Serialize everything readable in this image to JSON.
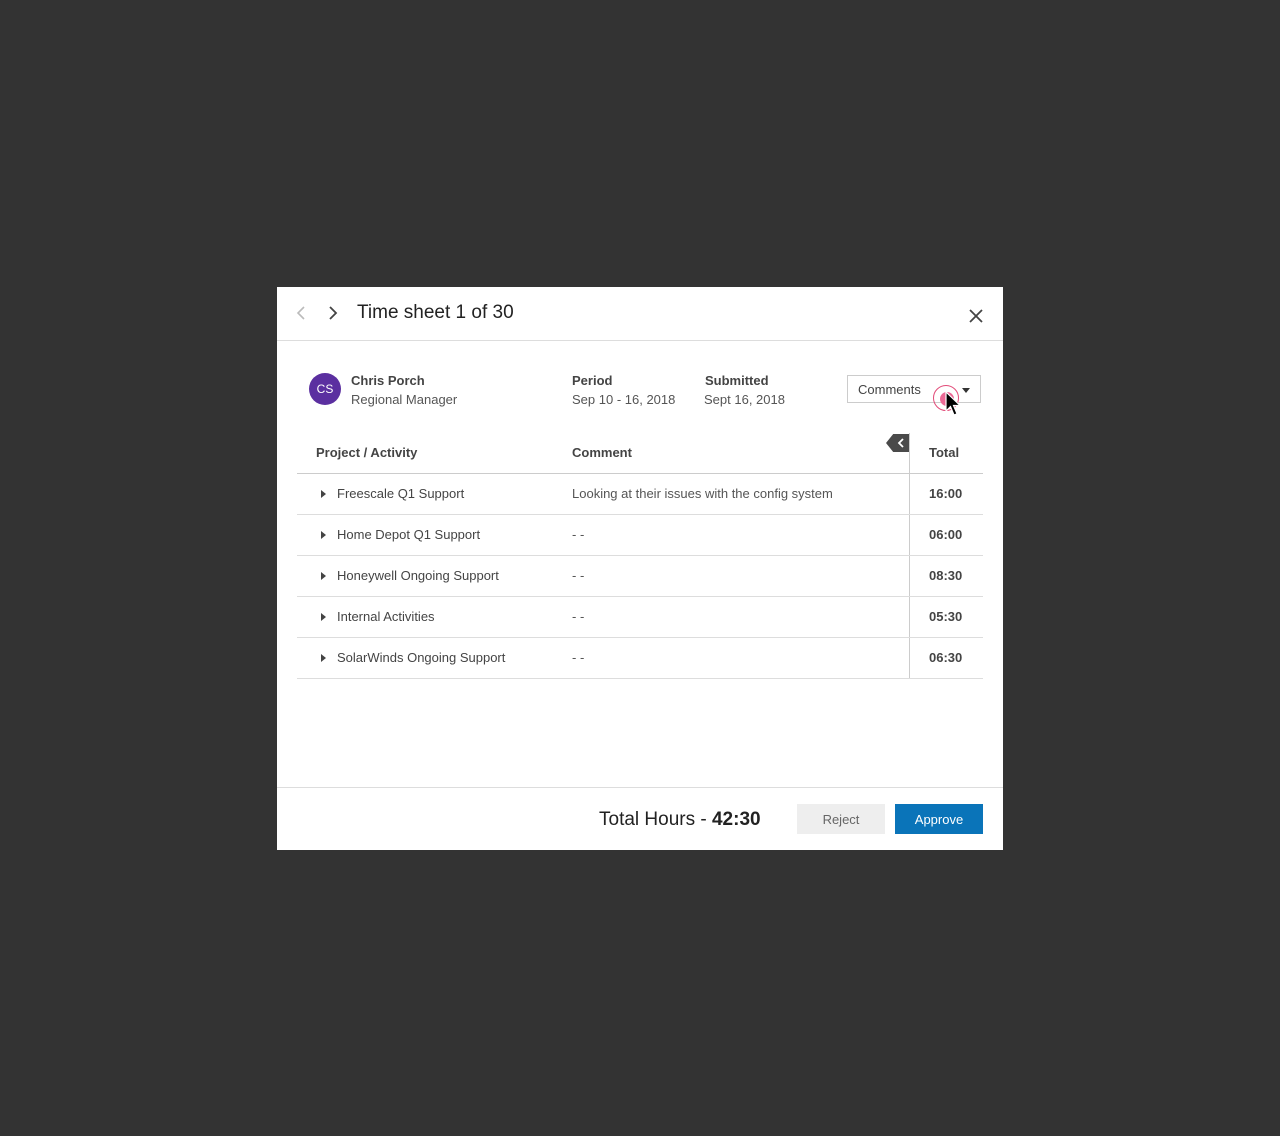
{
  "header": {
    "title": "Time sheet 1 of 30"
  },
  "user": {
    "initials": "CS",
    "avatar_color": "#5b2fa0",
    "name": "Chris Porch",
    "role": "Regional Manager"
  },
  "period": {
    "label": "Period",
    "value": "Sep 10 - 16, 2018"
  },
  "submitted": {
    "label": "Submitted",
    "value": "Sept 16, 2018"
  },
  "comments_dropdown": {
    "label": "Comments"
  },
  "table": {
    "columns": {
      "project": "Project / Activity",
      "comment": "Comment",
      "total": "Total"
    },
    "rows": [
      {
        "project": "Freescale Q1 Support",
        "comment": "Looking at their issues with the config system",
        "total": "16:00"
      },
      {
        "project": "Home Depot Q1 Support",
        "comment": "- -",
        "total": "06:00"
      },
      {
        "project": "Honeywell Ongoing Support",
        "comment": "- -",
        "total": "08:30"
      },
      {
        "project": "Internal Activities",
        "comment": "- -",
        "total": "05:30"
      },
      {
        "project": "SolarWinds Ongoing Support",
        "comment": "- -",
        "total": "06:30"
      }
    ]
  },
  "footer": {
    "total_label": "Total Hours -",
    "total_value": "42:30",
    "reject_label": "Reject",
    "approve_label": "Approve",
    "approve_color": "#0a74b9"
  }
}
